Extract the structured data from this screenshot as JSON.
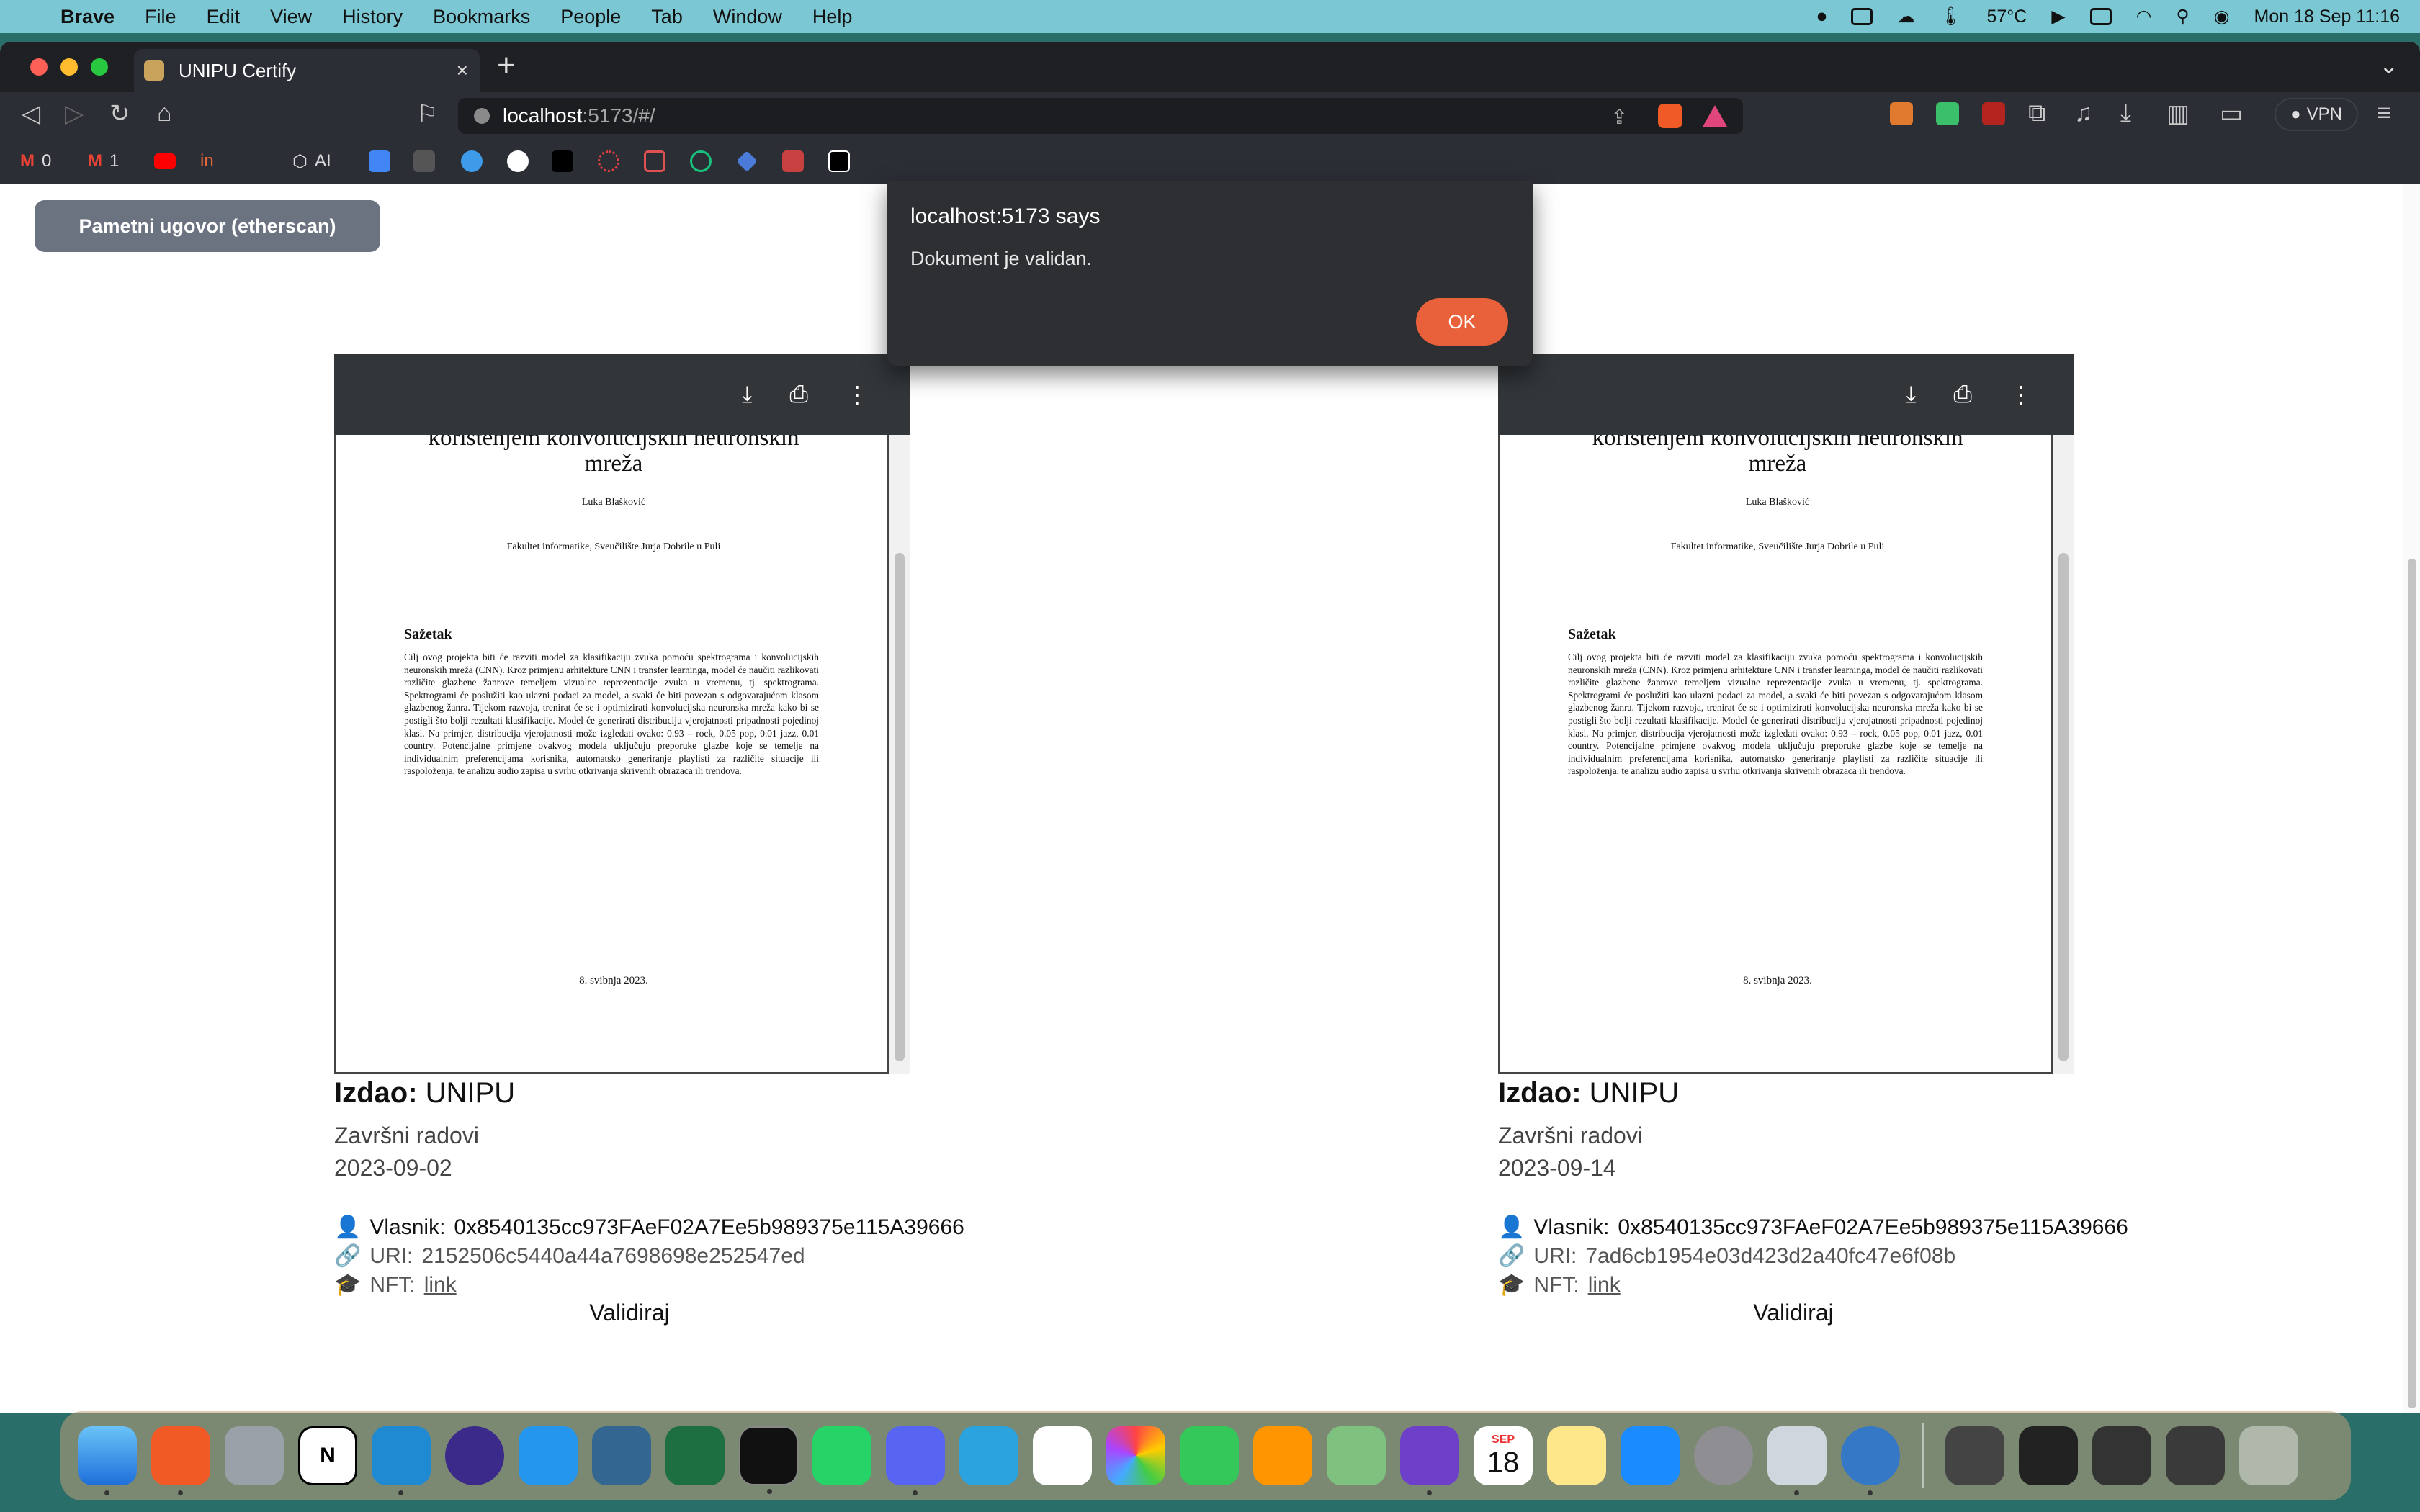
{
  "menubar": {
    "app_name": "Brave",
    "items": [
      "File",
      "Edit",
      "View",
      "History",
      "Bookmarks",
      "People",
      "Tab",
      "Window",
      "Help"
    ],
    "temperature": "57°C",
    "datetime": "Mon 18 Sep  11:16"
  },
  "browser": {
    "tab_title": "UNIPU Certify",
    "url_host": "localhost",
    "url_path": ":5173/#/",
    "vpn_label": "VPN",
    "bookmarks": [
      {
        "label": "0"
      },
      {
        "label": "1"
      },
      {
        "label": "AI"
      }
    ]
  },
  "page": {
    "contract_button": "Pametni ugovor (etherscan)",
    "cards": [
      {
        "issuer_label": "Izdao:",
        "issuer": "UNIPU",
        "category": "Završni radovi",
        "date": "2023-09-02",
        "owner_label": "Vlasnik:",
        "owner": "0x8540135cc973FAeF02A7Ee5b989375e115A39666",
        "uri_label": "URI:",
        "uri": "2152506c5440a44a7698698e252547ed",
        "nft_label": "NFT:",
        "nft_link": "link",
        "validate": "Validiraj"
      },
      {
        "issuer_label": "Izdao:",
        "issuer": "UNIPU",
        "category": "Završni radovi",
        "date": "2023-09-14",
        "owner_label": "Vlasnik:",
        "owner": "0x8540135cc973FAeF02A7Ee5b989375e115A39666",
        "uri_label": "URI:",
        "uri": "7ad6cb1954e03d423d2a40fc47e6f08b",
        "nft_label": "NFT:",
        "nft_link": "link",
        "validate": "Validiraj"
      }
    ],
    "pdf": {
      "title_line1": "korištenjem konvolucijskih neuronskih",
      "title_line2": "mreža",
      "author": "Luka Blašković",
      "faculty": "Fakultet informatike, Sveučilište Jurja Dobrile u Puli",
      "summary_heading": "Sažetak",
      "abstract": "Cilj ovog projekta biti će razviti model za klasifikaciju zvuka pomoću spektrograma i konvolucijskih neuronskih mreža (CNN). Kroz primjenu arhitekture CNN i transfer learninga, model će naučiti razlikovati različite glazbene žanrove temeljem vizualne reprezentacije zvuka u vremenu, tj. spektrograma. Spektrogrami će poslužiti kao ulazni podaci za model, a svaki će biti povezan s odgovarajućom klasom glazbenog žanra. Tijekom razvoja, trenirat će se i optimizirati konvolucijska neuronska mreža kako bi se postigli što bolji rezultati klasifikacije. Model će generirati distribuciju vjerojatnosti pripadnosti pojedinoj klasi. Na primjer, distribucija vjerojatnosti može izgledati ovako: 0.93 – rock, 0.05 pop, 0.01 jazz, 0.01 country. Potencijalne primjene ovakvog modela uključuju preporuke glazbe koje se temelje na individualnim preferencijama korisnika, automatsko generiranje playlisti za različite situacije ili raspoloženja, te analizu audio zapisa u svrhu otkrivanja skrivenih obrazaca ili trendova.",
      "date": "8. svibnja 2023."
    }
  },
  "dialog": {
    "title": "localhost:5173 says",
    "message": "Dokument je validan.",
    "ok": "OK"
  },
  "dock": {
    "calendar_month": "SEP",
    "calendar_day": "18"
  },
  "colors": {
    "menubar": "#7bc8d4",
    "contract_button": "#6b7381",
    "ok_button": "#e8613a",
    "pdf_toolbar": "#323639"
  }
}
